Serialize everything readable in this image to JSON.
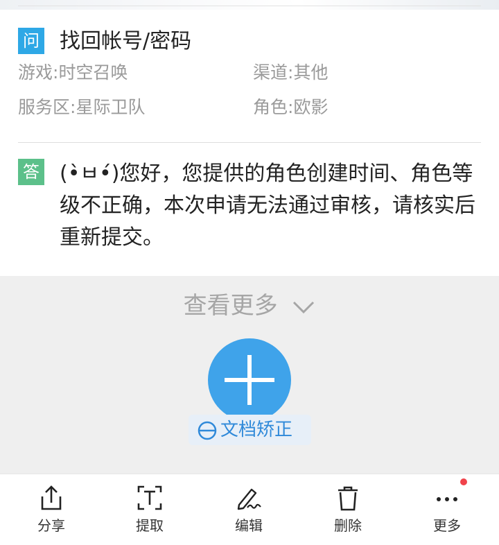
{
  "question": {
    "badge": "问",
    "title": "找回帐号/密码",
    "game_label": "游戏:",
    "game_value": "时空召唤",
    "channel_label": "渠道:",
    "channel_value": "其他",
    "server_label": "服务区:",
    "server_value": "星际卫队",
    "role_label": "角色:",
    "role_value": "欧影"
  },
  "answer": {
    "badge": "答",
    "text": "(•̀ㅂ•́)您好，您提供的角色创建时间、角色等级不正确，本次申请无法通过审核，请核实后重新提交。"
  },
  "see_more": "查看更多",
  "doc_correct": "文档矫正",
  "toolbar": {
    "share": "分享",
    "extract": "提取",
    "edit": "编辑",
    "delete": "删除",
    "more": "更多"
  },
  "colors": {
    "accent": "#3fa3ea",
    "question_badge": "#2ea8e6",
    "answer_badge": "#5cc08a",
    "notification_dot": "#f0434b"
  },
  "icons": {
    "fab": "plus-icon",
    "doc_correct": "doc-correct-icon",
    "share": "share-icon",
    "extract": "text-extract-icon",
    "edit": "signature-pen-icon",
    "delete": "trash-icon",
    "more": "more-dots-icon"
  }
}
